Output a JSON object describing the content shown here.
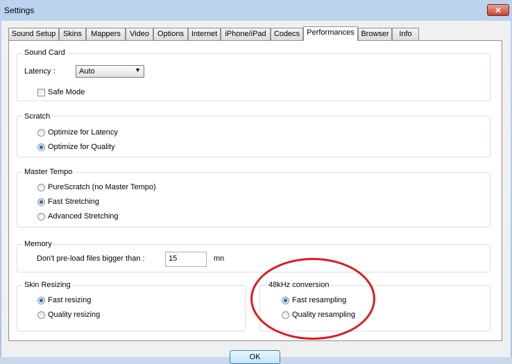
{
  "window": {
    "title": "Settings",
    "close_glyph": "✕"
  },
  "tabs": [
    {
      "label": "Sound Setup"
    },
    {
      "label": "Skins"
    },
    {
      "label": "Mappers"
    },
    {
      "label": "Video"
    },
    {
      "label": "Options"
    },
    {
      "label": "Internet"
    },
    {
      "label": "iPhone/iPad"
    },
    {
      "label": "Codecs"
    },
    {
      "label": "Performances",
      "active": true
    },
    {
      "label": "Browser"
    },
    {
      "label": "Info"
    }
  ],
  "sound_card": {
    "title": "Sound Card",
    "latency_label": "Latency :",
    "latency_value": "Auto",
    "safe_mode_label": "Safe Mode",
    "safe_mode_checked": false
  },
  "scratch": {
    "title": "Scratch",
    "options": [
      {
        "label": "Optimize for Latency",
        "selected": false
      },
      {
        "label": "Optimize for Quality",
        "selected": true
      }
    ]
  },
  "master_tempo": {
    "title": "Master Tempo",
    "options": [
      {
        "label": "PureScratch (no Master Tempo)",
        "selected": false
      },
      {
        "label": "Fast Stretching",
        "selected": true
      },
      {
        "label": "Advanced Stretching",
        "selected": false
      }
    ]
  },
  "memory": {
    "title": "Memory",
    "preload_label": "Don't pre-load files bigger than :",
    "preload_value": "15",
    "unit": "mn"
  },
  "skin_resizing": {
    "title": "Skin Resizing",
    "options": [
      {
        "label": "Fast resizing",
        "selected": true
      },
      {
        "label": "Quality resizing",
        "selected": false
      }
    ]
  },
  "conversion_48k": {
    "title": "48kHz conversion",
    "options": [
      {
        "label": "Fast resampling",
        "selected": true
      },
      {
        "label": "Quality resampling",
        "selected": false
      }
    ]
  },
  "footer": {
    "ok_label": "OK"
  },
  "annotation": {
    "color": "#e0191e"
  }
}
